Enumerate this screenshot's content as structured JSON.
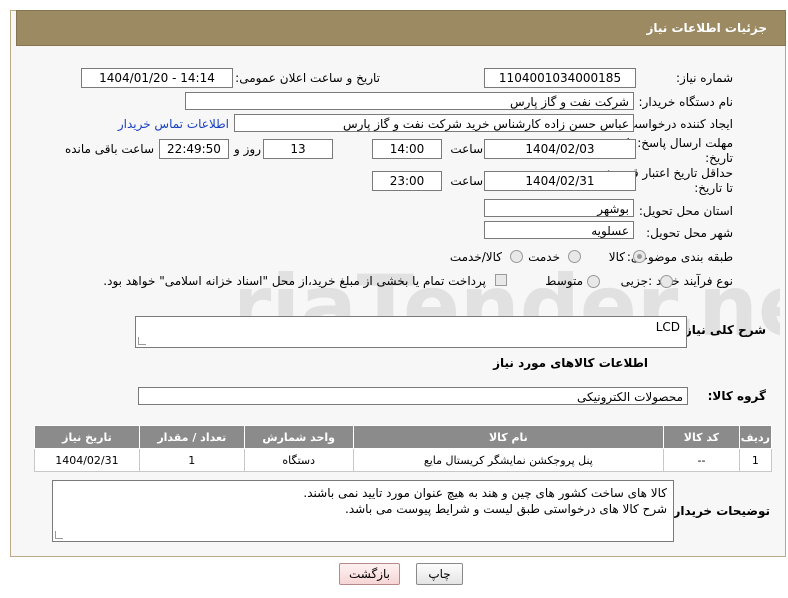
{
  "header": {
    "title": "جزئیات اطلاعات نیاز"
  },
  "fields": {
    "need_number_label": "شماره نیاز:",
    "need_number": "1104001034000185",
    "announce_label": "تاریخ و ساعت اعلان عمومی:",
    "announce_value": "1404/01/20 - 14:14",
    "buyer_org_label": "نام دستگاه خریدار:",
    "buyer_org": "شرکت نفت و گاز پارس",
    "creator_label": "ایجاد کننده درخواست:",
    "creator": "عباس حسن زاده کارشناس خرید شرکت نفت و گاز پارس",
    "contact_link": "اطلاعات تماس خریدار",
    "deadline_label": "مهلت ارسال پاسخ: تا تاریخ:",
    "deadline_date": "1404/02/03",
    "time_label": "ساعت",
    "deadline_time": "14:00",
    "days_value": "13",
    "days_label": "روز و",
    "remaining_time": "22:49:50",
    "remaining_label": "ساعت باقی مانده",
    "validity_label": "حداقل تاریخ اعتبار قیمت: تا تاریخ:",
    "validity_date": "1404/02/31",
    "validity_time": "23:00",
    "province_label": "استان محل تحویل:",
    "province": "بوشهر",
    "city_label": "شهر محل تحویل:",
    "city": "عسلویه",
    "category_label": "طبقه بندی موضوعی:",
    "category_options": [
      "کالا",
      "خدمت",
      "کالا/خدمت"
    ],
    "process_label": "نوع فرآیند خرید :",
    "process_options": [
      "جزیی",
      "متوسط"
    ],
    "process_note": "پرداخت تمام یا بخشی از مبلغ خرید،از محل \"اسناد خزانه اسلامی\" خواهد بود."
  },
  "description": {
    "label": "شرح کلی نیاز:",
    "value": "LCD"
  },
  "goods_section": {
    "title": "اطلاعات کالاهای مورد نیاز",
    "group_label": "گروه کالا:",
    "group_value": "محصولات الکترونیکی"
  },
  "table": {
    "headers": [
      "ردیف",
      "کد کالا",
      "نام کالا",
      "واحد شمارش",
      "تعداد / مقدار",
      "تاریخ نیاز"
    ],
    "rows": [
      [
        "1",
        "--",
        "پنل پروجکشن نمایشگر کریستال مایع",
        "دستگاه",
        "1",
        "1404/02/31"
      ]
    ]
  },
  "buyer_notes": {
    "label": "توضیحات خریدار:",
    "line1": "کالا های ساخت کشور های چین و هند به هیچ عنوان مورد تایید نمی باشند.",
    "line2": "شرح کالا های درخواستی طبق لیست و شرایط پیوست می باشد."
  },
  "buttons": {
    "print": "چاپ",
    "back": "بازگشت"
  },
  "watermark": {
    "text": "AriaTender.net"
  }
}
